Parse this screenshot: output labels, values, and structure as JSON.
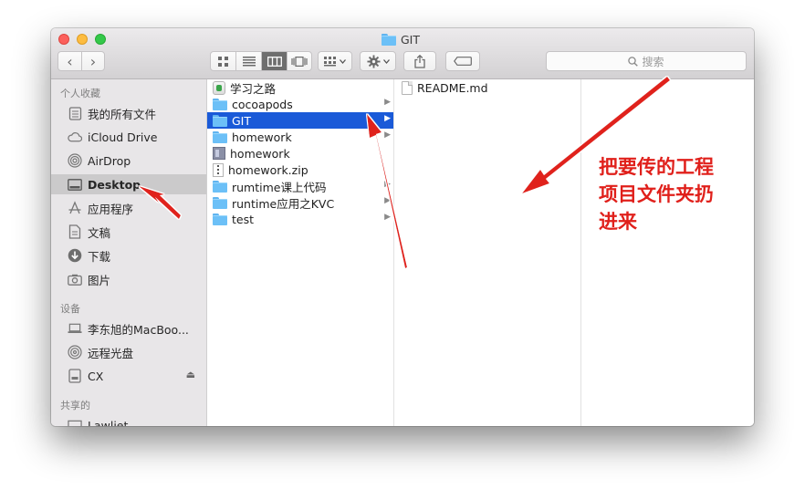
{
  "window": {
    "title": "GIT"
  },
  "toolbar": {
    "back": "‹",
    "forward": "›",
    "search_placeholder": "搜索"
  },
  "sidebar": {
    "favorites_header": "个人收藏",
    "favorites": [
      {
        "label": "我的所有文件",
        "icon": "all-files-icon"
      },
      {
        "label": "iCloud Drive",
        "icon": "cloud-icon"
      },
      {
        "label": "AirDrop",
        "icon": "airdrop-icon"
      },
      {
        "label": "Desktop",
        "icon": "desktop-icon",
        "selected": true
      },
      {
        "label": "应用程序",
        "icon": "applications-icon"
      },
      {
        "label": "文稿",
        "icon": "documents-icon"
      },
      {
        "label": "下载",
        "icon": "download-icon"
      },
      {
        "label": "图片",
        "icon": "pictures-icon"
      }
    ],
    "devices_header": "设备",
    "devices": [
      {
        "label": "李东旭的MacBoo...",
        "icon": "laptop-icon"
      },
      {
        "label": "远程光盘",
        "icon": "disc-icon"
      },
      {
        "label": "CX",
        "icon": "drive-icon",
        "eject": "⏏"
      }
    ],
    "shared_header": "共享的",
    "shared": [
      {
        "label": "Lawliet",
        "icon": "computer-icon"
      }
    ]
  },
  "column1": {
    "items": [
      {
        "label": "学习之路",
        "type": "app",
        "icon": "app-icon"
      },
      {
        "label": "cocoapods",
        "type": "folder",
        "icon": "folder-icon",
        "chevron": true
      },
      {
        "label": "GIT",
        "type": "folder",
        "icon": "folder-icon",
        "chevron": true,
        "selected": true
      },
      {
        "label": "homework",
        "type": "folder",
        "icon": "folder-icon",
        "chevron": true
      },
      {
        "label": "homework",
        "type": "exec",
        "icon": "executable-icon"
      },
      {
        "label": "homework.zip",
        "type": "zip",
        "icon": "zip-icon"
      },
      {
        "label": "rumtime课上代码",
        "type": "folder",
        "icon": "folder-icon",
        "chevron": true
      },
      {
        "label": "runtime应用之KVC",
        "type": "folder",
        "icon": "folder-icon",
        "chevron": true
      },
      {
        "label": "test",
        "type": "folder",
        "icon": "folder-icon",
        "chevron": true
      }
    ]
  },
  "column2": {
    "items": [
      {
        "label": "README.md",
        "type": "file",
        "icon": "document-icon"
      }
    ]
  },
  "annotation": {
    "lines": [
      "把要传的工程",
      "项目文件夹扔",
      "进来"
    ],
    "color": "#e0201b"
  },
  "colors": {
    "selection": "#1a5ad8",
    "sidebar_selection": "#cbcacb",
    "arrow": "#e0201b"
  }
}
